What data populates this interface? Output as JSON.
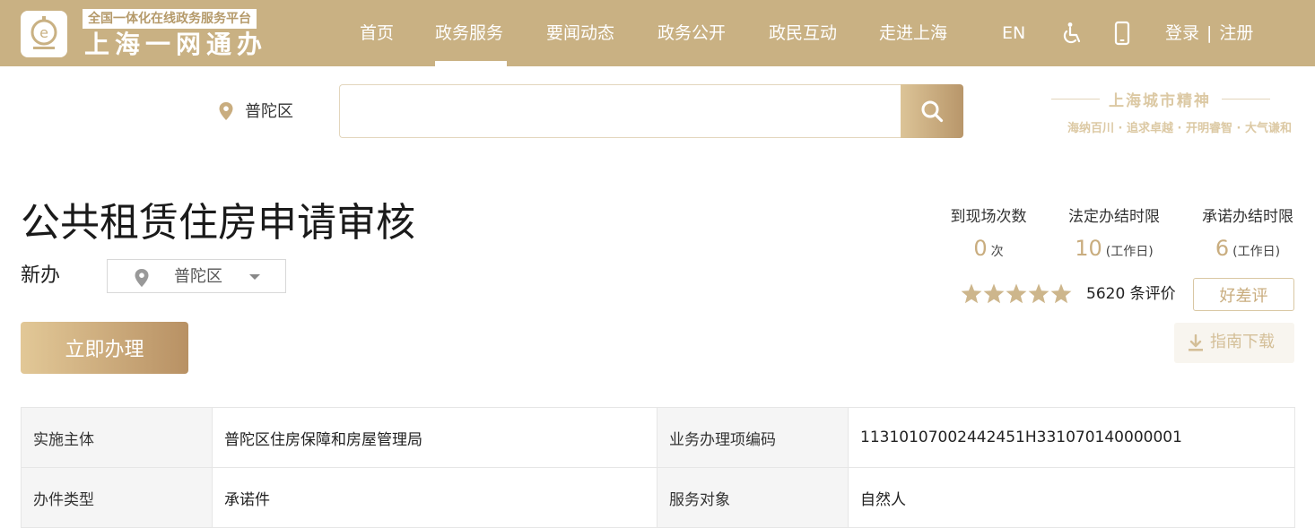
{
  "header": {
    "logo_tag": "全国一体化在线政务服务平台",
    "logo_name": "上海一网通办",
    "nav": [
      {
        "label": "首页"
      },
      {
        "label": "政务服务",
        "active": true
      },
      {
        "label": "要闻动态"
      },
      {
        "label": "政务公开"
      },
      {
        "label": "政民互动"
      },
      {
        "label": "走进上海"
      }
    ],
    "lang": "EN",
    "accessibility_icon": "wheelchair-icon",
    "mobile_icon": "mobile-phone-icon",
    "login": "登录",
    "separator": "|",
    "register": "注册"
  },
  "search": {
    "location": "普陀区",
    "placeholder": "",
    "icon": "search-icon"
  },
  "slogan": {
    "title": "上海城市精神",
    "subtitle": "海纳百川 · 追求卓越 · 开明睿智 · 大气谦和"
  },
  "service": {
    "title": "公共租赁住房申请审核",
    "type": "新办",
    "region": "普陀区",
    "apply_label": "立即办理"
  },
  "stats": [
    {
      "label": "到现场次数",
      "value": "0",
      "unit": "次"
    },
    {
      "label": "法定办结时限",
      "value": "10",
      "unit": "(工作日)"
    },
    {
      "label": "承诺办结时限",
      "value": "6",
      "unit": "(工作日)"
    }
  ],
  "rating": {
    "stars": 5,
    "max_stars": 5,
    "text": "5620 条评价",
    "rate_label": "好差评"
  },
  "guide_label": "指南下载",
  "info_table": [
    [
      "实施主体",
      "普陀区住房保障和房屋管理局",
      "业务办理项编码",
      "11310107002442451H331070140000001"
    ],
    [
      "办件类型",
      "承诺件",
      "服务对象",
      "自然人"
    ]
  ],
  "colors": {
    "header_bg": "#c9b183",
    "accent_gold": "#c9ad7f",
    "star": "#cdb68c"
  }
}
